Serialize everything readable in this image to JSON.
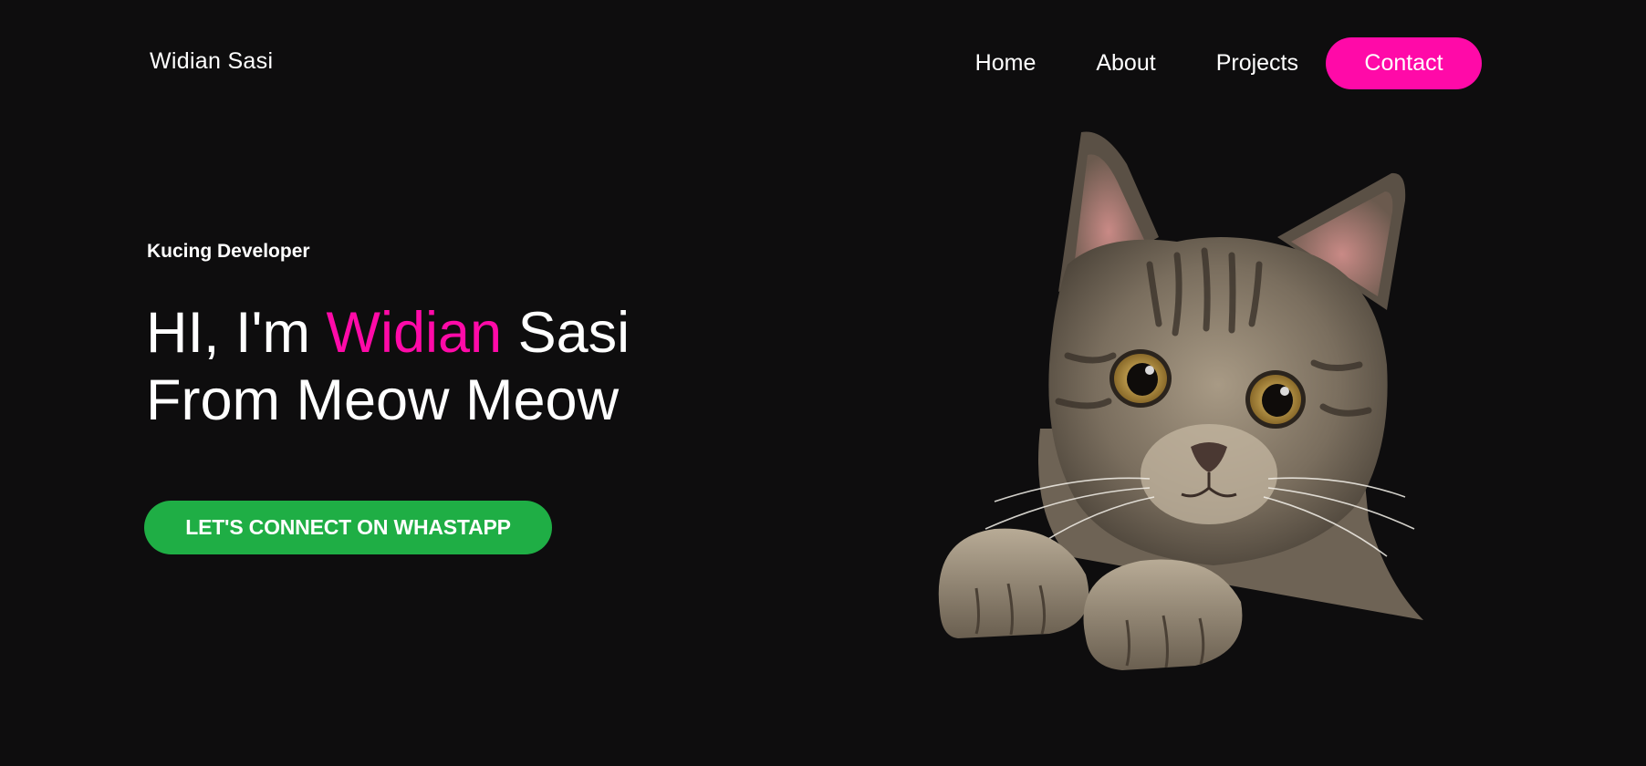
{
  "header": {
    "brand": "Widian Sasi",
    "nav": {
      "home": "Home",
      "about": "About",
      "projects": "Projects",
      "contact": "Contact"
    }
  },
  "hero": {
    "tagline": "Kucing Developer",
    "title": {
      "line1_prefix": "HI, I'm ",
      "line1_accent": "Widian",
      "line1_suffix": " Sasi",
      "line2": "From Meow Meow"
    },
    "cta_label": "LET'S CONNECT ON WHASTAPP",
    "image_icon": "tabby-cat-photo"
  },
  "colors": {
    "background": "#0e0d0e",
    "accent": "#ff0aa8",
    "cta": "#1fae45",
    "text": "#ffffff"
  }
}
